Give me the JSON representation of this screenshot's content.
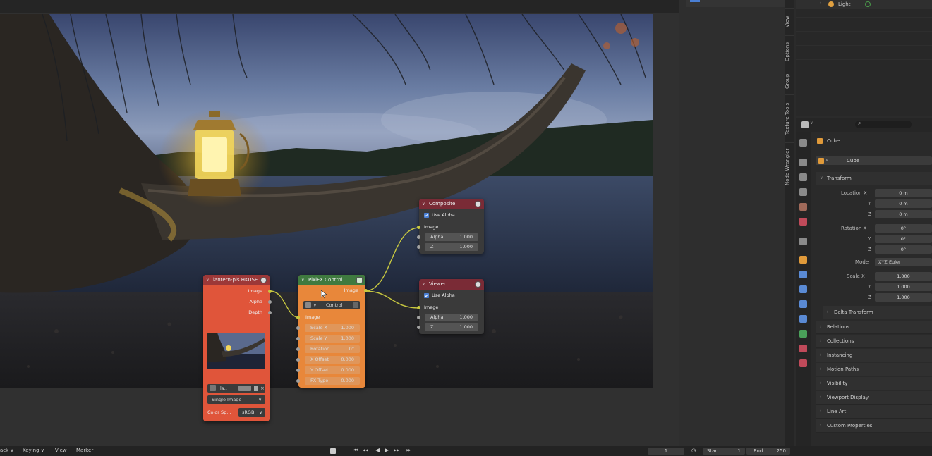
{
  "outliner": {
    "row_label": "Light",
    "row_icon": "light-bulb-icon"
  },
  "sidebar_tabs": [
    "View",
    "Options",
    "Group",
    "Texture Tools",
    "Node Wrangler"
  ],
  "nodes": {
    "image": {
      "title": "lantern-pls.HKUSE",
      "outputs": [
        "Image",
        "Alpha",
        "Depth"
      ],
      "image_field": "la..",
      "source": "Single Image",
      "color_space_label": "Color Sp...",
      "color_space_value": "sRGB"
    },
    "pixfx": {
      "title": "PixiFX Control",
      "output": "Image",
      "mode": "Control",
      "input": "Image",
      "fields": [
        {
          "label": "Scale X",
          "value": "1.000"
        },
        {
          "label": "Scale Y",
          "value": "1.000"
        },
        {
          "label": "Rotation",
          "value": "0°"
        },
        {
          "label": "X Offset",
          "value": "0.000"
        },
        {
          "label": "Y Offset",
          "value": "0.000"
        },
        {
          "label": "FX Type",
          "value": "0.000"
        }
      ]
    },
    "composite": {
      "title": "Composite",
      "use_alpha": "Use Alpha",
      "input": "Image",
      "fields": [
        {
          "label": "Alpha",
          "value": "1.000"
        },
        {
          "label": "Z",
          "value": "1.000"
        }
      ]
    },
    "viewer": {
      "title": "Viewer",
      "use_alpha": "Use Alpha",
      "input": "Image",
      "fields": [
        {
          "label": "Alpha",
          "value": "1.000"
        },
        {
          "label": "Z",
          "value": "1.000"
        }
      ]
    }
  },
  "properties": {
    "object_name": "Cube",
    "data_name": "Cube",
    "transform_title": "Transform",
    "location": [
      {
        "axis": "Location X",
        "value": "0 m"
      },
      {
        "axis": "Y",
        "value": "0 m"
      },
      {
        "axis": "Z",
        "value": "0 m"
      }
    ],
    "rotation": [
      {
        "axis": "Rotation X",
        "value": "0°"
      },
      {
        "axis": "Y",
        "value": "0°"
      },
      {
        "axis": "Z",
        "value": "0°"
      }
    ],
    "mode_label": "Mode",
    "mode_value": "XYZ Euler",
    "scale": [
      {
        "axis": "Scale X",
        "value": "1.000"
      },
      {
        "axis": "Y",
        "value": "1.000"
      },
      {
        "axis": "Z",
        "value": "1.000"
      }
    ],
    "delta_transform": "Delta Transform",
    "sections": [
      "Relations",
      "Collections",
      "Instancing",
      "Motion Paths",
      "Visibility",
      "Viewport Display",
      "Line Art",
      "Custom Properties"
    ]
  },
  "timeline": {
    "menus": [
      "ack ∨",
      "Keying ∨",
      "View",
      "Marker"
    ],
    "current_frame": "1",
    "start_label": "Start",
    "start_value": "1",
    "end_label": "End",
    "end_value": "250"
  }
}
